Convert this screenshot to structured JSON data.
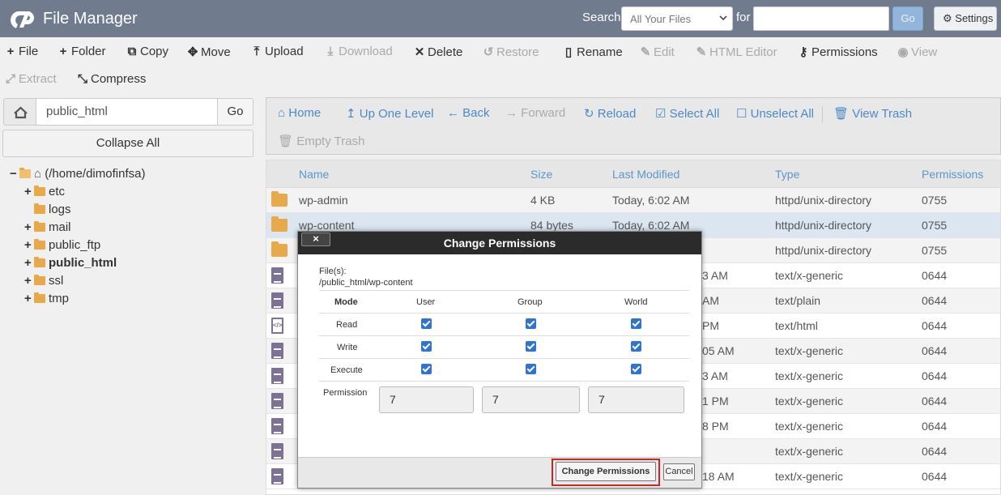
{
  "header": {
    "title": "File Manager",
    "search_label": "Search",
    "search_scope": "All Your Files",
    "for_label": "for",
    "search_value": "",
    "go_label": "Go",
    "settings_label": "Settings"
  },
  "toolbar": {
    "file": "File",
    "folder": "Folder",
    "copy": "Copy",
    "move": "Move",
    "upload": "Upload",
    "download": "Download",
    "delete": "Delete",
    "restore": "Restore",
    "rename": "Rename",
    "edit": "Edit",
    "html_editor": "HTML Editor",
    "permissions": "Permissions",
    "view": "View",
    "extract": "Extract",
    "compress": "Compress"
  },
  "sidebar": {
    "path": "public_html",
    "go_label": "Go",
    "collapse_label": "Collapse All",
    "tree": {
      "root": "(/home/dimofinfsa)",
      "items": [
        "etc",
        "logs",
        "mail",
        "public_ftp",
        "public_html",
        "ssl",
        "tmp"
      ]
    }
  },
  "nav": {
    "home": "Home",
    "up": "Up One Level",
    "back": "Back",
    "forward": "Forward",
    "reload": "Reload",
    "select_all": "Select All",
    "unselect_all": "Unselect All",
    "view_trash": "View Trash",
    "empty_trash": "Empty Trash"
  },
  "table": {
    "columns": [
      "Name",
      "Size",
      "Last Modified",
      "Type",
      "Permissions"
    ],
    "rows": [
      {
        "name": "wp-admin",
        "size": "4 KB",
        "modified": "Today, 6:02 AM",
        "type": "httpd/unix-directory",
        "perms": "0755"
      },
      {
        "name": "wp-content",
        "size": "84 bytes",
        "modified": "Today, 6:02 AM",
        "type": "httpd/unix-directory",
        "perms": "0755"
      },
      {
        "name": "",
        "size": "",
        "modified": "",
        "type": "httpd/unix-directory",
        "perms": "0755"
      },
      {
        "name": "",
        "size": "",
        "modified": "3 AM",
        "type": "text/x-generic",
        "perms": "0644"
      },
      {
        "name": "",
        "size": "",
        "modified": "AM",
        "type": "text/plain",
        "perms": "0644"
      },
      {
        "name": "",
        "size": "",
        "modified": "PM",
        "type": "text/html",
        "perms": "0644"
      },
      {
        "name": "",
        "size": "",
        "modified": "05 AM",
        "type": "text/x-generic",
        "perms": "0644"
      },
      {
        "name": "",
        "size": "",
        "modified": "3 AM",
        "type": "text/x-generic",
        "perms": "0644"
      },
      {
        "name": "",
        "size": "",
        "modified": "1 PM",
        "type": "text/x-generic",
        "perms": "0644"
      },
      {
        "name": "",
        "size": "",
        "modified": "8 PM",
        "type": "text/x-generic",
        "perms": "0644"
      },
      {
        "name": "",
        "size": "",
        "modified": "",
        "type": "text/x-generic",
        "perms": "0644"
      },
      {
        "name": "",
        "size": "",
        "modified": "18 AM",
        "type": "text/x-generic",
        "perms": "0644"
      }
    ]
  },
  "modal": {
    "title": "Change Permissions",
    "close": "×",
    "files_label": "File(s):",
    "files_value": "/public_html/wp-content",
    "headers": [
      "Mode",
      "User",
      "Group",
      "World"
    ],
    "modes": [
      "Read",
      "Write",
      "Execute"
    ],
    "checked": true,
    "permission_label": "Permission",
    "user_value": "7",
    "group_value": "7",
    "world_value": "7",
    "submit": "Change Permissions",
    "cancel": "Cancel"
  }
}
